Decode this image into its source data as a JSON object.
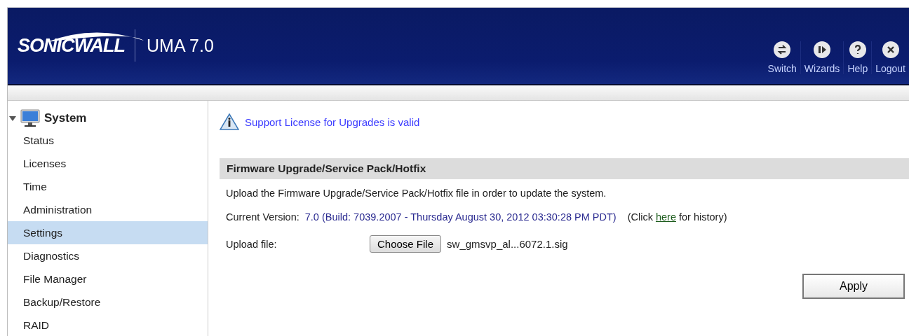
{
  "header": {
    "logo": "SONICWALL",
    "product": "UMA 7.0",
    "actions": [
      {
        "kind": "switch",
        "label": "Switch"
      },
      {
        "kind": "wizards",
        "label": "Wizards"
      },
      {
        "kind": "help",
        "label": "Help"
      },
      {
        "kind": "logout",
        "label": "Logout"
      }
    ]
  },
  "sidebar": {
    "group": {
      "label": "System",
      "expanded": true,
      "items": [
        {
          "label": "Status",
          "selected": false
        },
        {
          "label": "Licenses",
          "selected": false
        },
        {
          "label": "Time",
          "selected": false
        },
        {
          "label": "Administration",
          "selected": false
        },
        {
          "label": "Settings",
          "selected": true
        },
        {
          "label": "Diagnostics",
          "selected": false
        },
        {
          "label": "File Manager",
          "selected": false
        },
        {
          "label": "Backup/Restore",
          "selected": false
        },
        {
          "label": "RAID",
          "selected": false
        }
      ]
    }
  },
  "notice": "Support License for Upgrades is valid",
  "section": {
    "title": "Firmware Upgrade/Service Pack/Hotfix",
    "description": "Upload the Firmware Upgrade/Service Pack/Hotfix file in order to update the system.",
    "version_label": "Current Version:",
    "version_value": "7.0 (Build: 7039.2007 - Thursday August 30, 2012 03:30:28 PM PDT)",
    "history": {
      "before": "(Click",
      "link": "here",
      "after": "for history)"
    },
    "upload_label": "Upload file:",
    "choose_button": "Choose File",
    "file_name": "sw_gmsvp_al...6072.1.sig",
    "apply_button": "Apply"
  }
}
